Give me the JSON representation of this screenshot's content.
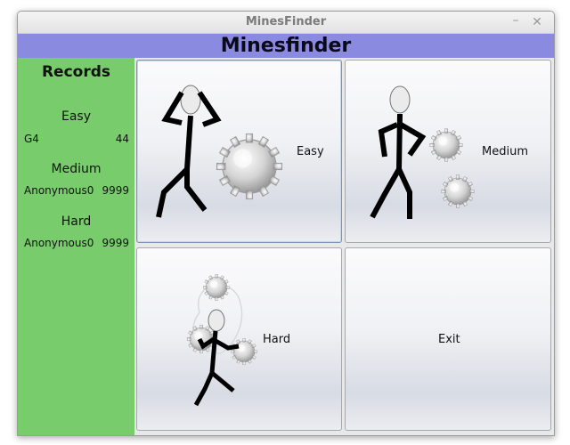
{
  "window": {
    "title": "MinesFinder",
    "minimize_glyph": "–",
    "close_glyph": "✕"
  },
  "banner": {
    "title": "Minesfinder"
  },
  "records": {
    "heading": "Records",
    "levels": [
      {
        "name": "Easy",
        "player": "G4",
        "score": "44"
      },
      {
        "name": "Medium",
        "player": "Anonymous0",
        "score": "9999"
      },
      {
        "name": "Hard",
        "player": "Anonymous0",
        "score": "9999"
      }
    ]
  },
  "buttons": {
    "easy": "Easy",
    "medium": "Medium",
    "hard": "Hard",
    "exit": "Exit"
  },
  "colors": {
    "banner": "#8a8ae0",
    "sidebar": "#78cc6c"
  },
  "icons": [
    "stick-figure-icon",
    "mine-gear-icon",
    "minimize-icon",
    "close-icon"
  ]
}
